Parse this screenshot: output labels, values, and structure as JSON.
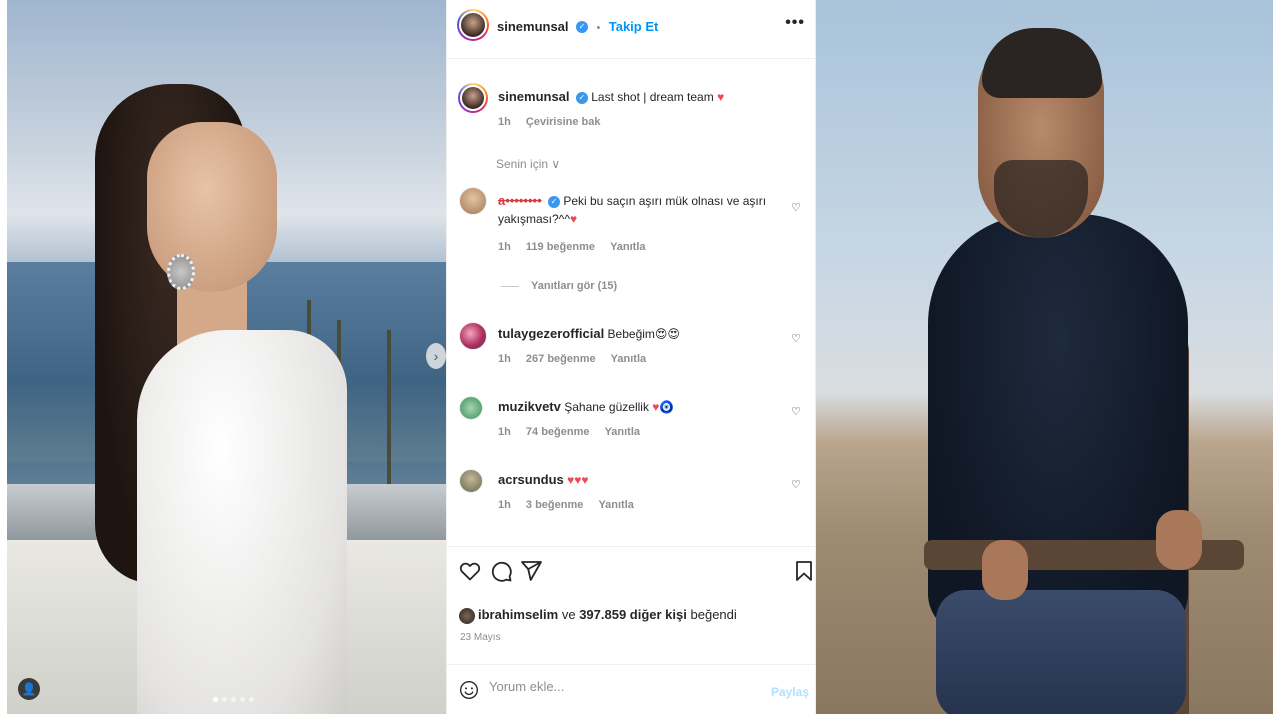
{
  "post": {
    "header": {
      "username": "sinemunsal",
      "separator": "•",
      "follow_label": "Takip Et",
      "more_label": "•••"
    },
    "caption": {
      "username": "sinemunsal",
      "text": "Last shot | dream team",
      "emoji": "♥",
      "time": "1h",
      "translate_label": "Çevirisine bak"
    },
    "sort_label": "Senin için ∨",
    "comments": [
      {
        "username": "a••••••••",
        "text": "Peki bu saçın aşırı mük olnası ve aşırı yakışması?^^",
        "emoji": "♥",
        "time": "1h",
        "likes": "119 beğenme",
        "reply_label": "Yanıtla"
      },
      {
        "username": "tulaygezerofficial",
        "text": "Bebeğim",
        "emoji": "😍😍",
        "time": "1h",
        "likes": "267 beğenme",
        "reply_label": "Yanıtla"
      },
      {
        "username": "muzikvetv",
        "text": "Şahane güzellik",
        "emoji": "♥🧿",
        "time": "1h",
        "likes": "74 beğenme",
        "reply_label": "Yanıtla"
      },
      {
        "username": "acrsundus",
        "text": "",
        "emoji": "♥♥♥",
        "time": "1h",
        "likes": "3 beğenme",
        "reply_label": "Yanıtla"
      }
    ],
    "view_replies": "Yanıtları gör (15)",
    "liked_by_user": "ibrahimselim",
    "liked_by_connector": "ve",
    "liked_by_rest": "397.859 diğer kişi",
    "liked_by_suffix": "beğendi",
    "date": "23 Mayıs",
    "comment_placeholder": "Yorum ekle...",
    "share_label": "Paylaş"
  },
  "colors": {
    "accent": "#0095f6",
    "like_red": "#ed4956",
    "muted": "#8e8e8e",
    "text": "#262626"
  },
  "carousel": {
    "current": 1,
    "total": 5
  }
}
